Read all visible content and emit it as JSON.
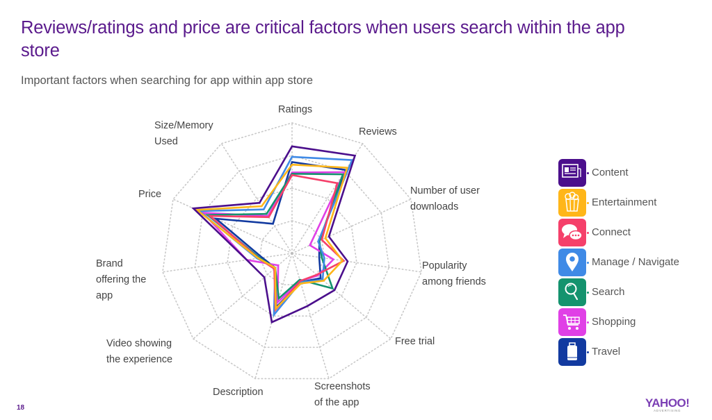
{
  "header": {
    "title": "Reviews/ratings and price are critical factors when users search within the app store",
    "subtitle": "Important factors when searching for app within app store"
  },
  "footer": {
    "page_number": "18",
    "logo_text": "YAHOO!",
    "logo_subtext": "ADVERTISING"
  },
  "chart_data": {
    "type": "radar",
    "title": "Important factors when searching for app within app store",
    "axes": [
      "Ratings",
      "Reviews",
      "Number of user downloads",
      "Popularity among friends",
      "Free trial",
      "Screenshots of the app",
      "Description",
      "Video showing the experience",
      "Brand offering the app",
      "Price",
      "Size/Memory Used"
    ],
    "axis_labels_display": [
      [
        "Ratings"
      ],
      [
        "Reviews"
      ],
      [
        "Number of user",
        "downloads"
      ],
      [
        "Popularity",
        "among friends"
      ],
      [
        "Free trial"
      ],
      [
        "Screenshots",
        "of the app"
      ],
      [
        "Description"
      ],
      [
        "Video showing",
        "the experience"
      ],
      [
        "Brand",
        "offering the",
        "app"
      ],
      [
        "Price"
      ],
      [
        "Size/Memory",
        "Used"
      ]
    ],
    "range": [
      0,
      1
    ],
    "grid_levels": [
      0.25,
      0.5,
      0.75,
      1.0
    ],
    "grid": true,
    "legend_position": "right",
    "series": [
      {
        "name": "Content",
        "color": "#4b0f8c",
        "icon": "newspaper-icon",
        "values": [
          0.82,
          0.89,
          0.31,
          0.43,
          0.43,
          0.42,
          0.55,
          0.28,
          0.35,
          0.83,
          0.46
        ]
      },
      {
        "name": "Entertainment",
        "color": "#ffb619",
        "icon": "popcorn-icon",
        "values": [
          0.68,
          0.78,
          0.28,
          0.39,
          0.32,
          0.24,
          0.44,
          0.17,
          0.26,
          0.8,
          0.43
        ]
      },
      {
        "name": "Connect",
        "color": "#f5406a",
        "icon": "chat-bubbles-icon",
        "values": [
          0.6,
          0.64,
          0.25,
          0.4,
          0.25,
          0.22,
          0.45,
          0.18,
          0.26,
          0.69,
          0.33
        ]
      },
      {
        "name": "Manage / Navigate",
        "color": "#3f8ae6",
        "icon": "map-pin-icon",
        "values": [
          0.74,
          0.85,
          0.22,
          0.25,
          0.31,
          0.23,
          0.49,
          0.17,
          0.27,
          0.78,
          0.4
        ]
      },
      {
        "name": "Search",
        "color": "#14936e",
        "icon": "magnifier-icon",
        "values": [
          0.61,
          0.72,
          0.23,
          0.23,
          0.41,
          0.21,
          0.36,
          0.17,
          0.25,
          0.71,
          0.36
        ]
      },
      {
        "name": "Shopping",
        "color": "#e040e6",
        "icon": "shopping-cart-icon",
        "values": [
          0.62,
          0.74,
          0.15,
          0.32,
          0.26,
          0.22,
          0.39,
          0.14,
          0.35,
          0.75,
          0.34
        ]
      },
      {
        "name": "Travel",
        "color": "#123aa0",
        "icon": "suitcase-icon",
        "values": [
          0.7,
          0.76,
          0.23,
          0.21,
          0.29,
          0.23,
          0.43,
          0.17,
          0.23,
          0.64,
          0.27
        ]
      }
    ]
  }
}
